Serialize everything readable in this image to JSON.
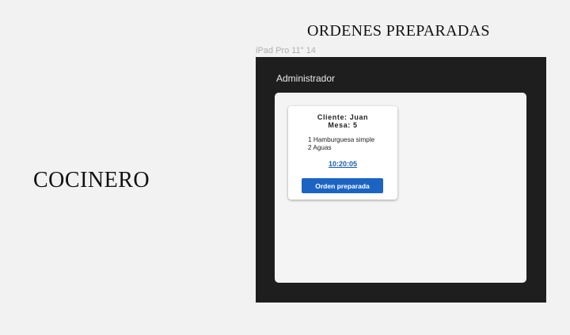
{
  "left_title": "COCINERO",
  "top_title": "ORDENES PREPARADAS",
  "frame_label": "iPad Pro 11\"  14",
  "header": {
    "title": "Administrador"
  },
  "order": {
    "client": "Cliente: Juan",
    "table": "Mesa: 5",
    "items": [
      "1 Hamburguesa simple",
      "2 Aguas"
    ],
    "timer": "10:20:05",
    "button_label": "Orden preparada"
  },
  "colors": {
    "accent": "#1c64c4",
    "timer": "#1a5fb4",
    "device_bg": "#1e1e1e",
    "canvas_bg": "#f2f2f2"
  }
}
